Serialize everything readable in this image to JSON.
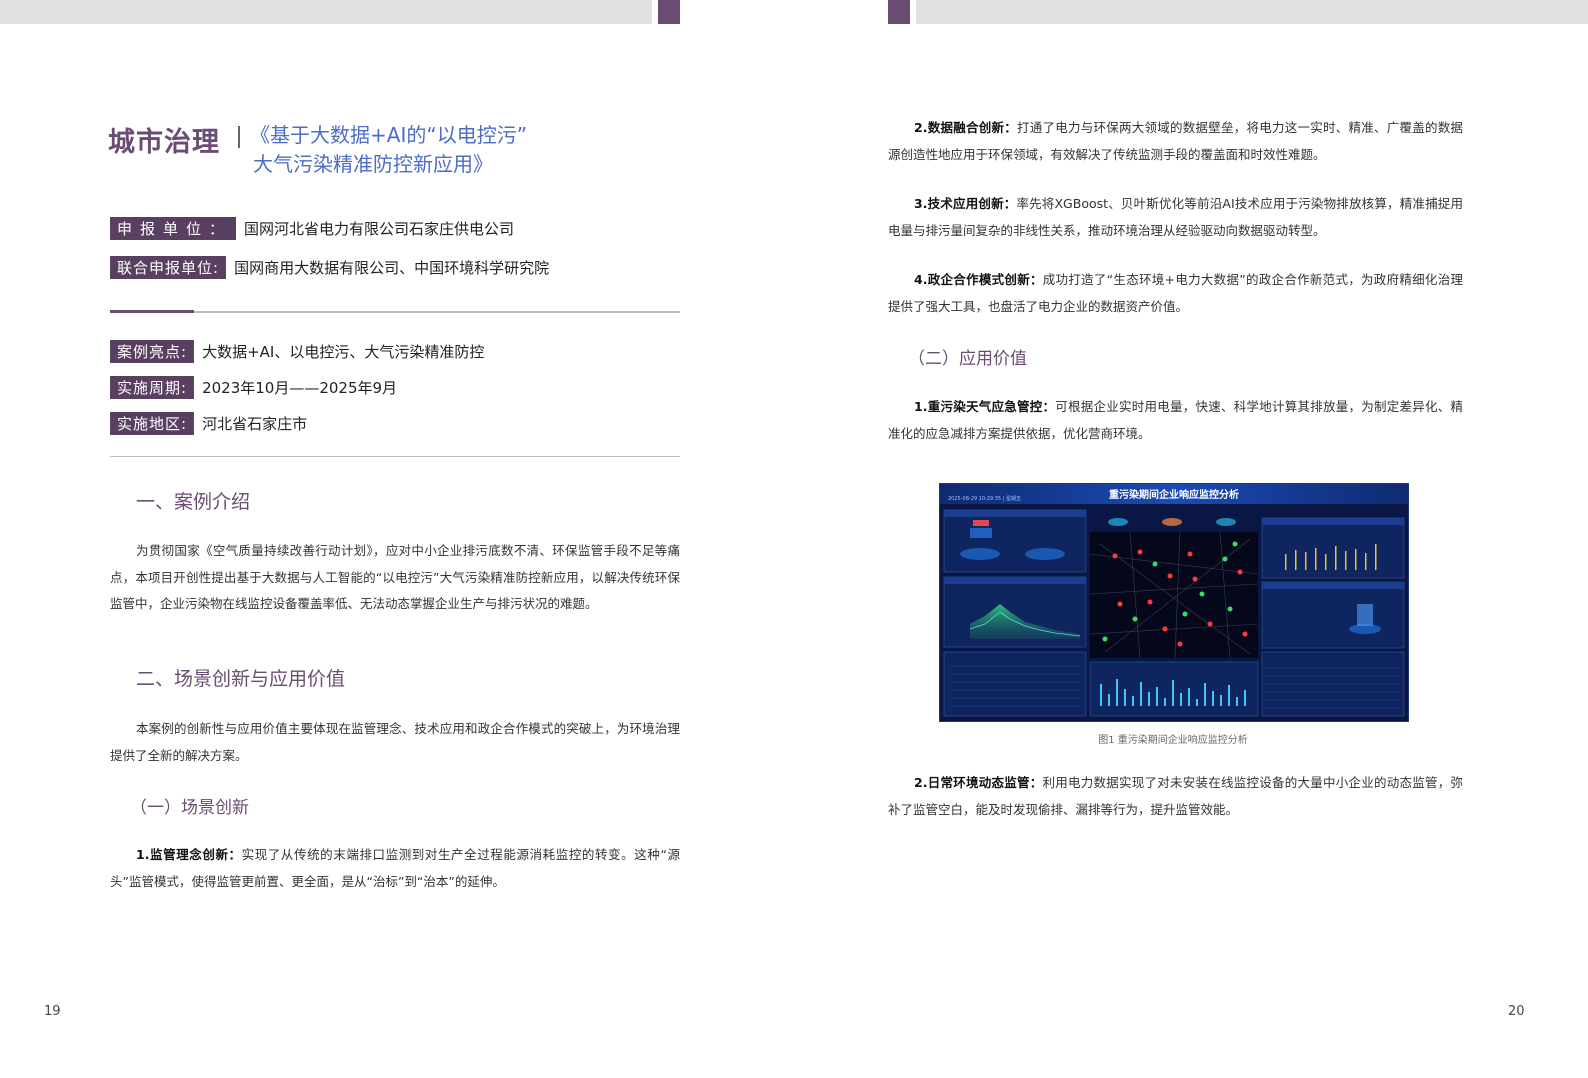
{
  "left_page": {
    "page_number": "19",
    "category": "城市治理",
    "title_line1": "《基于大数据+AI的“以电控污”",
    "title_line2": "大气污染精准防控新应用》",
    "meta": [
      {
        "label": "申报单位：",
        "value": "国网河北省电力有限公司石家庄供电公司"
      },
      {
        "label": "联合申报单位:",
        "value": "国网商用大数据有限公司、中国环境科学研究院"
      }
    ],
    "details": [
      {
        "label": "案例亮点:",
        "value": "大数据+AI、以电控污、大气污染精准防控"
      },
      {
        "label": "实施周期:",
        "value": "2023年10月——2025年9月"
      },
      {
        "label": "实施地区:",
        "value": "河北省石家庄市"
      }
    ],
    "section1_heading": "一、案例介绍",
    "section1_text": "为贯彻国家《空气质量持续改善行动计划》，应对中小企业排污底数不清、环保监管手段不足等痛点，本项目开创性提出基于大数据与人工智能的“以电控污”大气污染精准防控新应用，以解决传统环保监管中，企业污染物在线监控设备覆盖率低、无法动态掌握企业生产与排污状况的难题。",
    "section2_heading": "二、场景创新与应用价值",
    "section2_text": "本案例的创新性与应用价值主要体现在监管理念、技术应用和政企合作模式的突破上，为环境治理提供了全新的解决方案。",
    "sub1_heading": "（一）场景创新",
    "item1_bold": "1.监管理念创新：",
    "item1_text": "实现了从传统的末端排口监测到对生产全过程能源消耗监控的转变。这种“源头”监管模式，使得监管更前置、更全面，是从“治标”到“治本”的延伸。"
  },
  "right_page": {
    "page_number": "20",
    "item2_bold": "2.数据融合创新：",
    "item2_text": "打通了电力与环保两大领域的数据壁垒，将电力这一实时、精准、广覆盖的数据源创造性地应用于环保领域，有效解决了传统监测手段的覆盖面和时效性难题。",
    "item3_bold": "3.技术应用创新：",
    "item3_text": "率先将XGBoost、贝叶斯优化等前沿AI技术应用于污染物排放核算，精准捕捉用电量与排污量间复杂的非线性关系，推动环境治理从经验驱动向数据驱动转型。",
    "item4_bold": "4.政企合作模式创新：",
    "item4_text": "成功打造了“生态环境+电力大数据”的政企合作新范式，为政府精细化治理提供了强大工具，也盘活了电力企业的数据资产价值。",
    "sub2_heading": "（二）应用价值",
    "value1_bold": "1.重污染天气应急管控：",
    "value1_text": "可根据企业实时用电量，快速、科学地计算其排放量，为制定差异化、精准化的应急减排方案提供依据，优化营商环境。",
    "figure": {
      "screen_title": "重污染期间企业响应监控分析",
      "datetime": "2025-08-29 10:29:35 | 星期五",
      "caption": "图1 重污染期间企业响应监控分析",
      "accent": "#5ec8ff",
      "bg": "#0a1745"
    },
    "value2_bold": "2.日常环境动态监管：",
    "value2_text": "利用电力数据实现了对未安装在线监控设备的大量中小企业的动态监管，弥补了监管空白，能及时发现偷排、漏排等行为，提升监管效能。"
  },
  "colors": {
    "brand_purple": "#6b4c72",
    "label_bg": "#5a4060",
    "title_blue": "#4d6cc8"
  }
}
